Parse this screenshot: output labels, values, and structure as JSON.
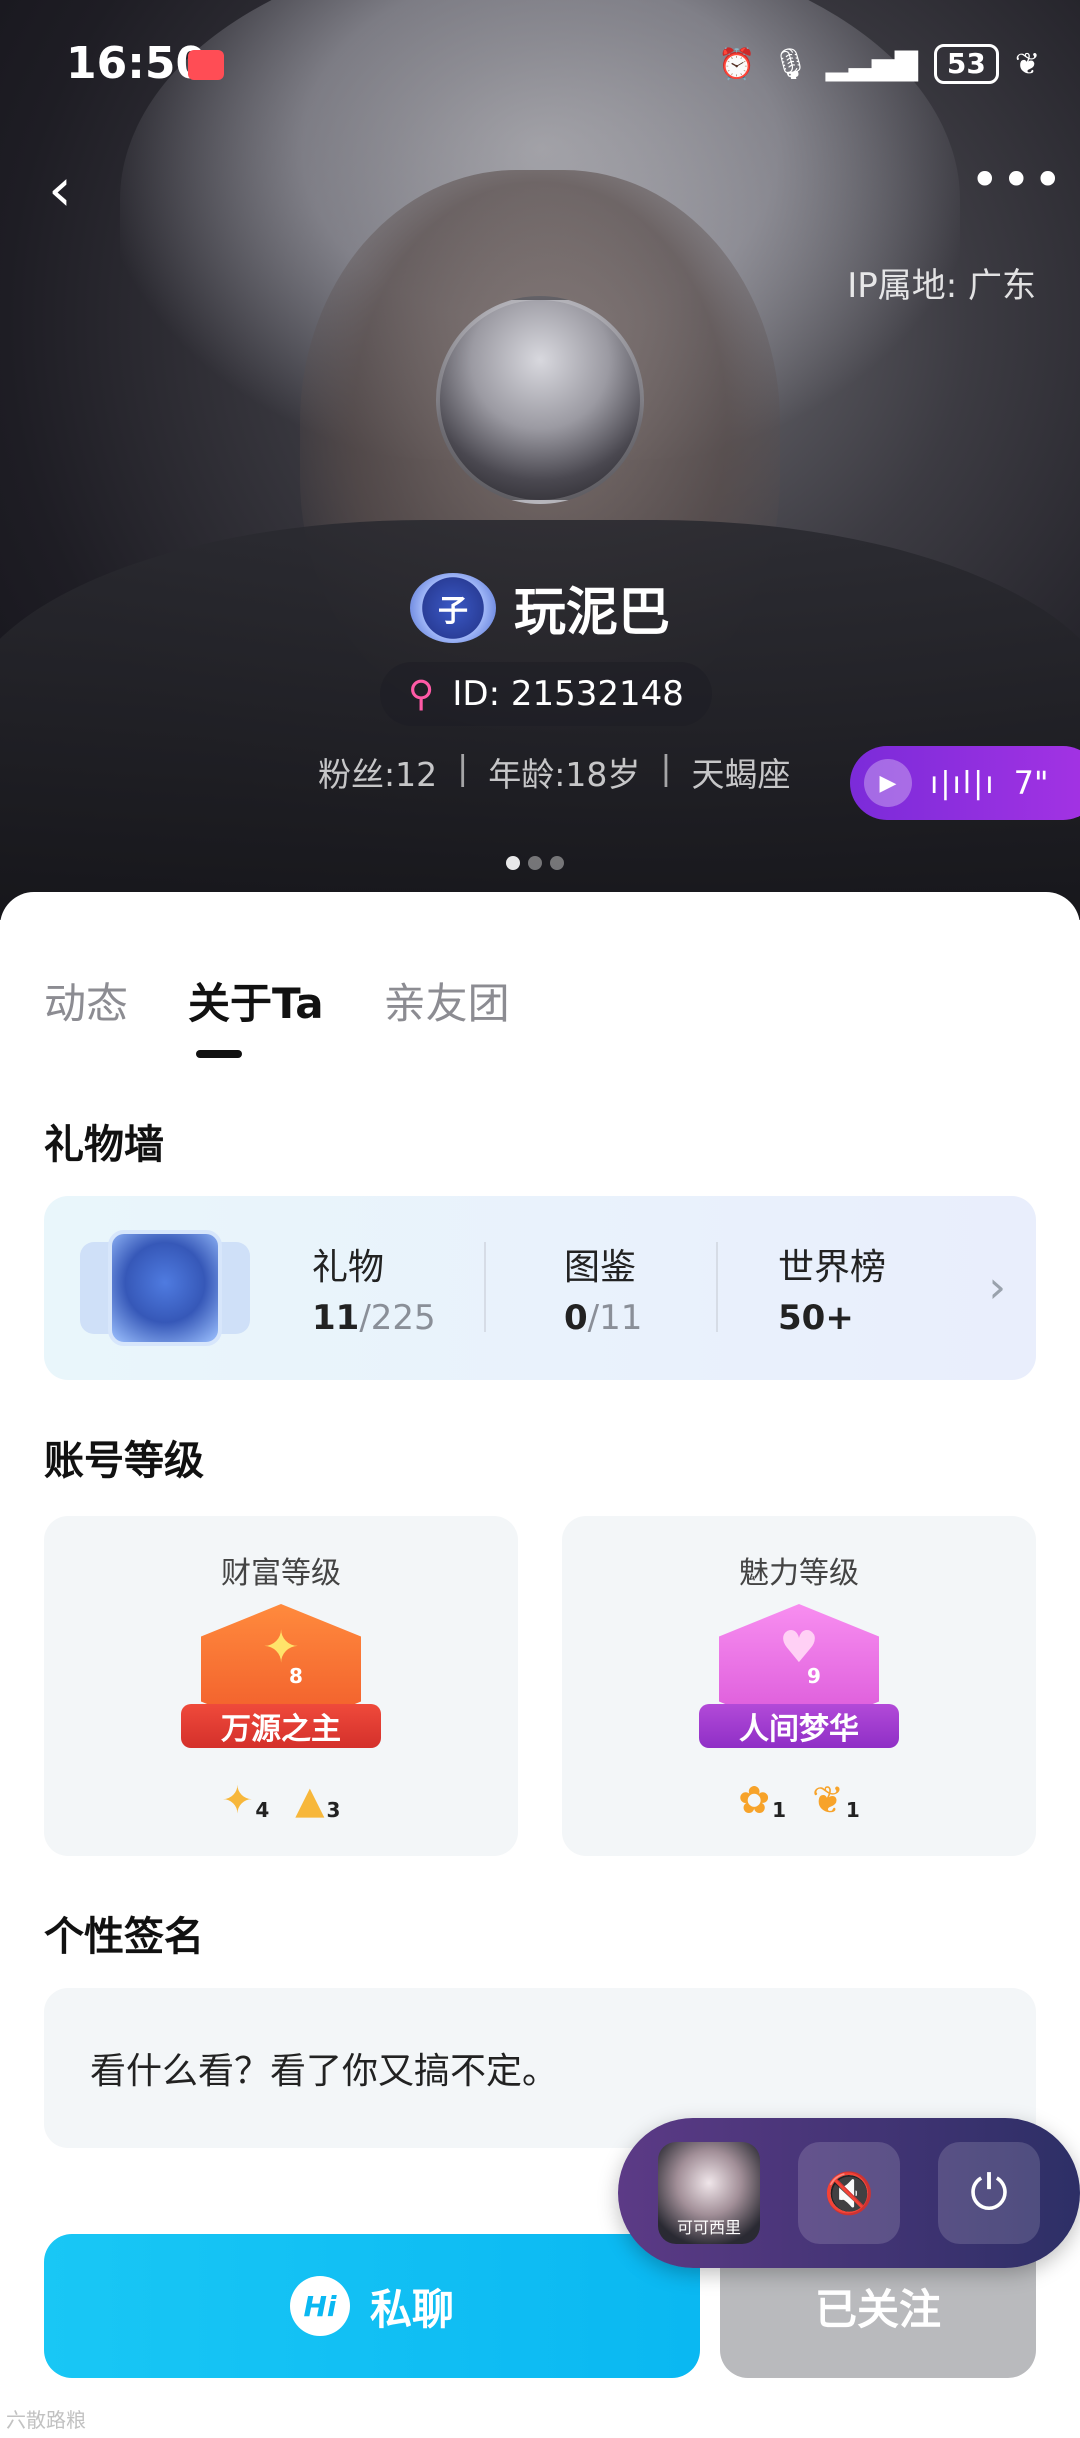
{
  "status_bar": {
    "time": "16:50",
    "battery": "53",
    "icons": [
      "alarm-icon",
      "mic-icon",
      "signal-icon",
      "battery-icon",
      "leaf-icon"
    ]
  },
  "header": {
    "back_icon": "chevron-left-icon",
    "more_icon": "more-dots-icon",
    "ip_location": "IP属地: 广东"
  },
  "profile": {
    "badge_char": "子",
    "name": "玩泥巴",
    "id_text": "ID: 21532148",
    "fans": "粉丝:12",
    "age": "年龄:18岁",
    "zodiac": "天蝎座",
    "separator": "|",
    "voice_duration": "7\"",
    "carousel": {
      "count": 3,
      "active_index": 0
    }
  },
  "tabs": [
    {
      "label": "动态",
      "active": false
    },
    {
      "label": "关于Ta",
      "active": true
    },
    {
      "label": "亲友团",
      "active": false
    }
  ],
  "gift_wall": {
    "title": "礼物墙",
    "stats": [
      {
        "label": "礼物",
        "value": "11",
        "total": "/225"
      },
      {
        "label": "图鉴",
        "value": "0",
        "total": "/11"
      },
      {
        "label": "世界榜",
        "value": "50+",
        "total": ""
      }
    ]
  },
  "account_level": {
    "title": "账号等级",
    "wealth": {
      "title": "财富等级",
      "badge_level": "8",
      "rank_name": "万源之主",
      "mini_badges": [
        {
          "icon": "star-icon",
          "num": "4"
        },
        {
          "icon": "triangle-icon",
          "num": "3"
        }
      ],
      "colors": {
        "primary": "#f05a2a",
        "ribbon": "#d4302b"
      }
    },
    "charm": {
      "title": "魅力等级",
      "badge_level": "9",
      "rank_name": "人间梦华",
      "mini_badges": [
        {
          "icon": "flower-icon",
          "num": "1"
        },
        {
          "icon": "leaf-icon",
          "num": "1"
        }
      ],
      "colors": {
        "primary": "#d955d8",
        "ribbon": "#8f2fc6"
      }
    }
  },
  "signature": {
    "title": "个性签名",
    "text": "看什么看？看了你又搞不定。"
  },
  "actions": {
    "chat_icon_text": "Hi",
    "chat_label": "私聊",
    "follow_label": "已关注",
    "colors": {
      "chat": "#0ab8f2",
      "follow": "#b9babd"
    }
  },
  "mini_player": {
    "caption": "可可西里",
    "mute_icon": "speaker-mute-icon",
    "power_icon": "power-icon"
  },
  "watermark": "六散路粮"
}
